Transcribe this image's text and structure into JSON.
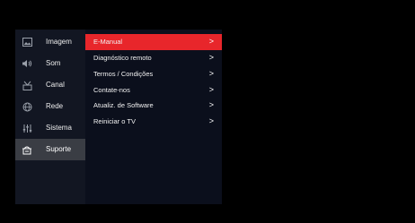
{
  "menu": {
    "categories": [
      {
        "label": "Imagem",
        "icon": "picture-icon"
      },
      {
        "label": "Som",
        "icon": "speaker-icon"
      },
      {
        "label": "Canal",
        "icon": "antenna-icon"
      },
      {
        "label": "Rede",
        "icon": "globe-icon"
      },
      {
        "label": "Sistema",
        "icon": "sliders-icon"
      },
      {
        "label": "Suporte",
        "icon": "support-icon"
      }
    ],
    "selected_category": "Suporte",
    "submenu": [
      {
        "label": "E-Manual"
      },
      {
        "label": "Diagnóstico remoto"
      },
      {
        "label": "Termos / Condições"
      },
      {
        "label": "Contate-nos"
      },
      {
        "label": "Atualiz. de Software"
      },
      {
        "label": "Reiniciar o TV"
      }
    ],
    "highlighted_submenu": "E-Manual",
    "chevron": ">"
  },
  "colors": {
    "highlight": "#e8262b",
    "selected_category_bg": "#3a3d44",
    "panel_bg": "#121622",
    "background": "#000000"
  }
}
